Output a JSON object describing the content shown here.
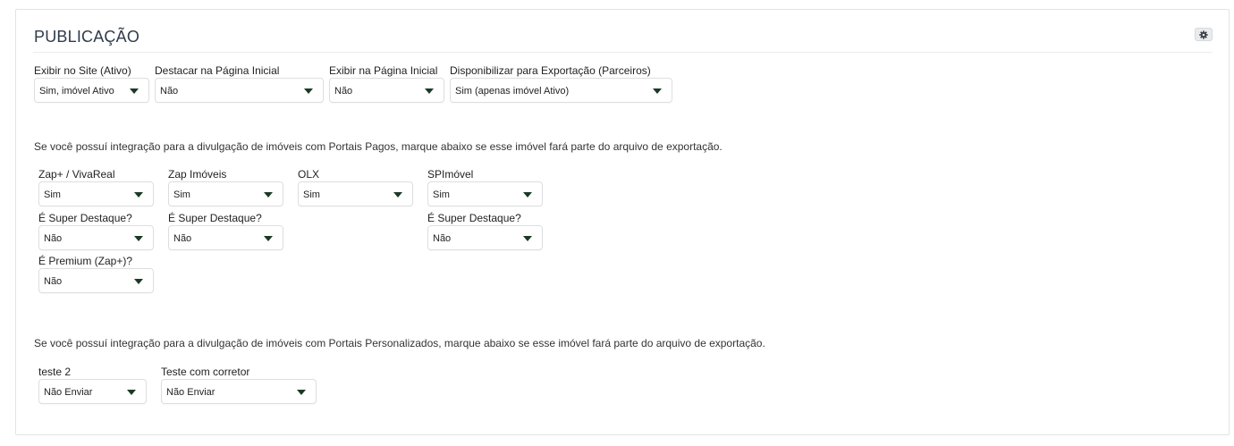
{
  "section": {
    "title": "PUBLICAÇÃO",
    "settings_icon": "gear-icon"
  },
  "site": {
    "exibir_site": {
      "label": "Exibir no Site (Ativo)",
      "value": "Sim, imóvel Ativo"
    },
    "destacar_inicial": {
      "label": "Destacar na Página Inicial",
      "value": "Não"
    },
    "exibir_inicial": {
      "label": "Exibir na Página Inicial",
      "value": "Não"
    },
    "exportacao": {
      "label": "Disponibilizar para Exportação (Parceiros)",
      "value": "Sim (apenas imóvel Ativo)"
    }
  },
  "paid_portals": {
    "note": "Se você possuí integração para a divulgação de imóveis com Portais Pagos, marque abaixo se esse imóvel fará parte do arquivo de exportação.",
    "zap_vivareal": {
      "label": "Zap+ / VivaReal",
      "value": "Sim"
    },
    "zap_imoveis": {
      "label": "Zap Imóveis",
      "value": "Sim"
    },
    "olx": {
      "label": "OLX",
      "value": "Sim"
    },
    "spimovel": {
      "label": "SPImóvel",
      "value": "Sim"
    },
    "zap_vivareal_super": {
      "label": "É Super Destaque?",
      "value": "Não"
    },
    "zap_imoveis_super": {
      "label": "É Super Destaque?",
      "value": "Não"
    },
    "spimovel_super": {
      "label": "É Super Destaque?",
      "value": "Não"
    },
    "zap_premium": {
      "label": "É Premium (Zap+)?",
      "value": "Não"
    }
  },
  "custom_portals": {
    "note": "Se você possuí integração para a divulgação de imóveis com Portais Personalizados, marque abaixo se esse imóvel fará parte do arquivo de exportação.",
    "teste2": {
      "label": "teste 2",
      "value": "Não Enviar"
    },
    "teste_corretor": {
      "label": "Teste com corretor",
      "value": "Não Enviar"
    }
  }
}
